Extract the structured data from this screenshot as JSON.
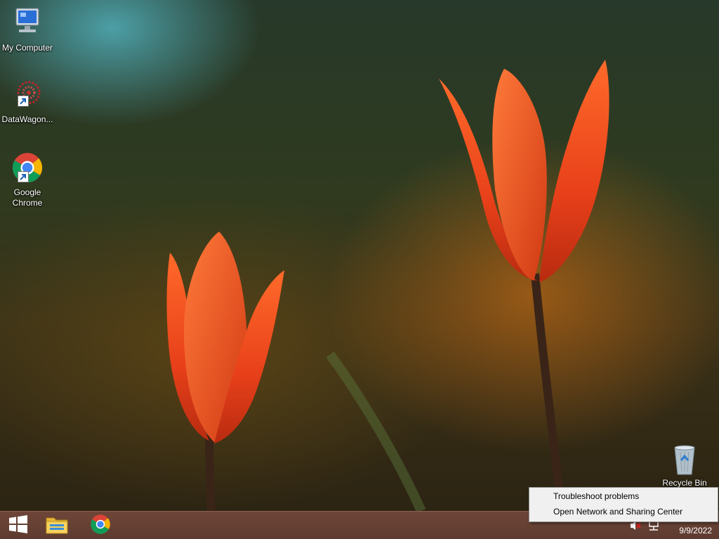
{
  "desktop": {
    "icons": [
      {
        "label": "My Computer",
        "icon": "my-computer-icon"
      },
      {
        "label": "DataWagon...",
        "icon": "datawagon-icon"
      },
      {
        "label": "Google Chrome",
        "icon": "chrome-icon"
      },
      {
        "label": "Recycle Bin",
        "icon": "recycle-bin-icon"
      }
    ]
  },
  "taskbar": {
    "start_icon": "windows-logo-icon",
    "pinned": [
      {
        "name": "File Explorer",
        "icon": "file-explorer-icon"
      },
      {
        "name": "Google Chrome",
        "icon": "chrome-icon"
      }
    ],
    "tray": {
      "volume_icon": "volume-muted-icon",
      "network_icon": "network-icon",
      "time": "",
      "date": "9/9/2022"
    }
  },
  "context_menu": {
    "items": [
      {
        "label": "Troubleshoot problems"
      },
      {
        "label": "Open Network and Sharing Center"
      }
    ]
  },
  "colors": {
    "taskbar": "#5d3b30",
    "menu_bg": "#f0f0f0",
    "tulip": "#e8451a"
  }
}
